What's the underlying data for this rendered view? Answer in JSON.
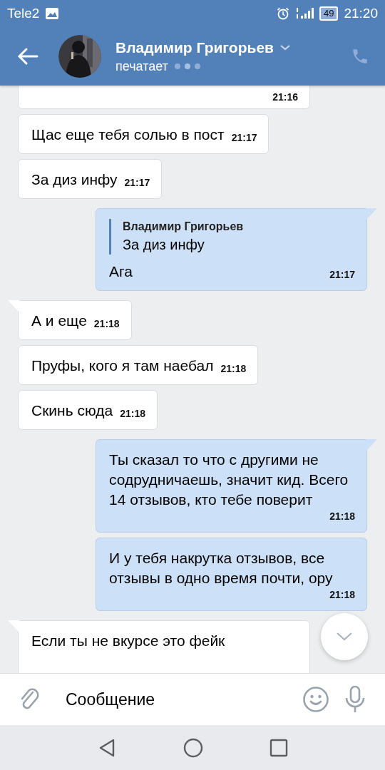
{
  "status_bar": {
    "carrier": "Tele2",
    "battery": "49",
    "time": "21:20"
  },
  "header": {
    "name": "Владимир Григорьев",
    "status": "печатает"
  },
  "messages": [
    {
      "kind": "incoming",
      "tail": false,
      "time": "21:16"
    },
    {
      "kind": "incoming",
      "tail": false,
      "text": "Щас еще тебя солью в пост",
      "time": "21:17"
    },
    {
      "kind": "incoming",
      "tail": false,
      "text": "За диз инфу",
      "time": "21:17"
    },
    {
      "kind": "outgoing",
      "tail": true,
      "quote": {
        "author": "Владимир Григорьев",
        "text": "За диз инфу"
      },
      "text": "Ага",
      "time": "21:17"
    },
    {
      "kind": "incoming",
      "tail": true,
      "text": "А и еще",
      "time": "21:18"
    },
    {
      "kind": "incoming",
      "tail": false,
      "text": "Пруфы, кого я там наебал",
      "time": "21:18"
    },
    {
      "kind": "incoming",
      "tail": false,
      "text": "Скинь сюда",
      "time": "21:18"
    },
    {
      "kind": "outgoing",
      "tail": true,
      "text": "Ты сказал то что  с другими не содрудничаешь, значит кид. Всего 14 отзывов, кто тебе поверит",
      "time": "21:18"
    },
    {
      "kind": "outgoing",
      "tail": false,
      "text": "И у тебя накрутка отзывов, все отзывы в одно время почти, ору",
      "time": "21:18"
    },
    {
      "kind": "incoming",
      "tail": true,
      "text": "Если ты не вкурсе это фейк"
    }
  ],
  "composer": {
    "placeholder": "Сообщение"
  }
}
